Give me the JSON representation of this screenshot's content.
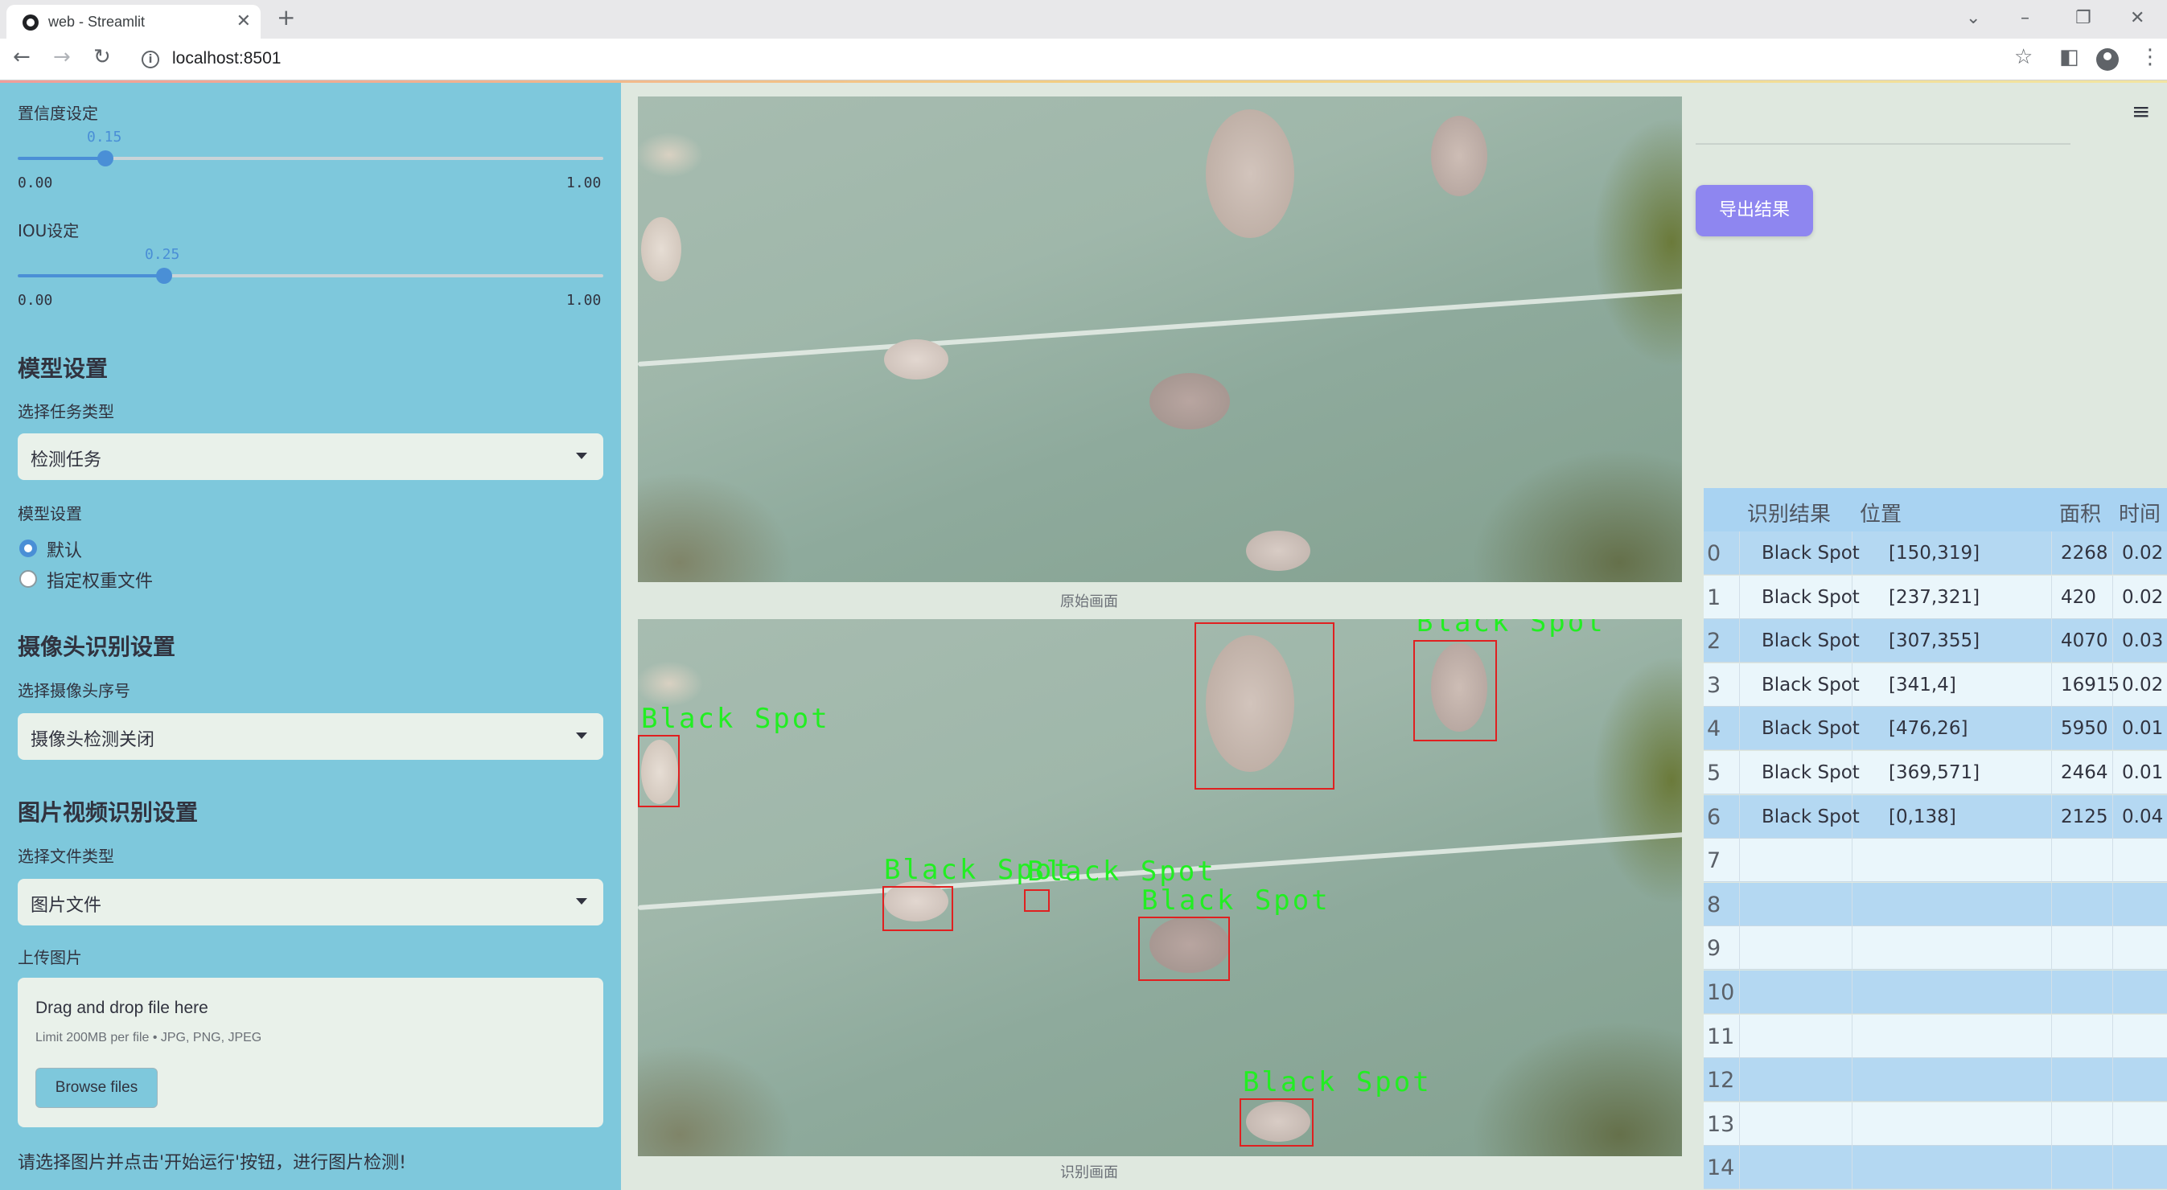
{
  "browser": {
    "tab_title": "web - Streamlit",
    "url": "localhost:8501"
  },
  "sidebar": {
    "confidence": {
      "label": "置信度设定",
      "value": "0.15",
      "min": "0.00",
      "max": "1.00",
      "fraction": 0.15
    },
    "iou": {
      "label": "IOU设定",
      "value": "0.25",
      "min": "0.00",
      "max": "1.00",
      "fraction": 0.25
    },
    "model_section": {
      "heading": "模型设置",
      "task_label": "选择任务类型",
      "task_value": "检测任务",
      "model_label": "模型设置",
      "radio_options": [
        "默认",
        "指定权重文件"
      ],
      "radio_selected": 0
    },
    "camera_section": {
      "heading": "摄像头识别设置",
      "label": "选择摄像头序号",
      "value": "摄像头检测关闭"
    },
    "media_section": {
      "heading": "图片视频识别设置",
      "file_type_label": "选择文件类型",
      "file_type_value": "图片文件",
      "upload_label": "上传图片",
      "drop_title": "Drag and drop file here",
      "drop_limit": "Limit 200MB per file • JPG, PNG, JPEG",
      "browse_label": "Browse files"
    },
    "hint": "请选择图片并点击'开始运行'按钮，进行图片检测!"
  },
  "main": {
    "original_caption": "原始画面",
    "result_caption": "识别画面",
    "detection_label": "Black Spot",
    "export_label": "导出结果",
    "menu_icon": "hamburger-menu-icon"
  },
  "table": {
    "headers": [
      "识别结果",
      "位置",
      "面积",
      "时间"
    ],
    "rows": [
      {
        "idx": "0",
        "result": "Black Spot",
        "pos": "[150,319]",
        "area": "2268",
        "time": "0.02"
      },
      {
        "idx": "1",
        "result": "Black Spot",
        "pos": "[237,321]",
        "area": "420",
        "time": "0.02"
      },
      {
        "idx": "2",
        "result": "Black Spot",
        "pos": "[307,355]",
        "area": "4070",
        "time": "0.03"
      },
      {
        "idx": "3",
        "result": "Black Spot",
        "pos": "[341,4]",
        "area": "16915",
        "time": "0.02"
      },
      {
        "idx": "4",
        "result": "Black Spot",
        "pos": "[476,26]",
        "area": "5950",
        "time": "0.01"
      },
      {
        "idx": "5",
        "result": "Black Spot",
        "pos": "[369,571]",
        "area": "2464",
        "time": "0.01"
      },
      {
        "idx": "6",
        "result": "Black Spot",
        "pos": "[0,138]",
        "area": "2125",
        "time": "0.04"
      },
      {
        "idx": "7",
        "result": "",
        "pos": "",
        "area": "",
        "time": ""
      },
      {
        "idx": "8",
        "result": "",
        "pos": "",
        "area": "",
        "time": ""
      },
      {
        "idx": "9",
        "result": "",
        "pos": "",
        "area": "",
        "time": ""
      },
      {
        "idx": "10",
        "result": "",
        "pos": "",
        "area": "",
        "time": ""
      },
      {
        "idx": "11",
        "result": "",
        "pos": "",
        "area": "",
        "time": ""
      },
      {
        "idx": "12",
        "result": "",
        "pos": "",
        "area": "",
        "time": ""
      },
      {
        "idx": "13",
        "result": "",
        "pos": "",
        "area": "",
        "time": ""
      },
      {
        "idx": "14",
        "result": "",
        "pos": "",
        "area": "",
        "time": ""
      }
    ]
  },
  "colors": {
    "sidebar": "#7ec8dc",
    "accent": "#4a8fd6",
    "export": "#8e86f0",
    "box": "#e02020",
    "label": "#22ee22"
  }
}
